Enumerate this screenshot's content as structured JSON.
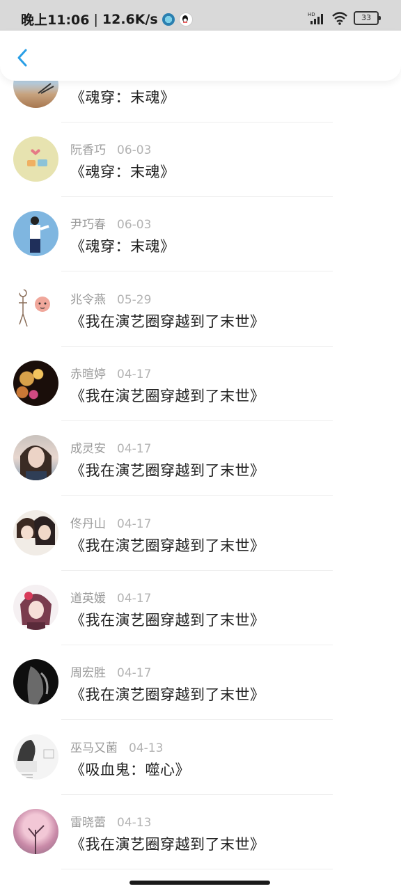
{
  "status_bar": {
    "time": "晚上11:06",
    "separator": "|",
    "speed": "12.6K/s",
    "battery": "33",
    "hd_label": "HD"
  },
  "header": {
    "back_icon": "chevron-left-icon"
  },
  "colors": {
    "accent": "#2a9fe6",
    "divider": "#eeeeee",
    "name_gray": "#9a9a9a"
  },
  "rows": [
    {
      "name": "",
      "date": "",
      "book": "《魂穿：末魂》",
      "avatar": "beach-avatar"
    },
    {
      "name": "阮香巧",
      "date": "06-03",
      "book": "《魂穿：末魂》",
      "avatar": "cute-items-avatar"
    },
    {
      "name": "尹巧春",
      "date": "06-03",
      "book": "《魂穿：末魂》",
      "avatar": "boy-illustration-avatar"
    },
    {
      "name": "兆令燕",
      "date": "05-29",
      "book": "《我在演艺圈穿越到了末世》",
      "avatar": "cartoon-avatar"
    },
    {
      "name": "赤暄婷",
      "date": "04-17",
      "book": "《我在演艺圈穿越到了末世》",
      "avatar": "bokeh-lights-avatar"
    },
    {
      "name": "成灵安",
      "date": "04-17",
      "book": "《我在演艺圈穿越到了末世》",
      "avatar": "woman-photo-avatar"
    },
    {
      "name": "佟丹山",
      "date": "04-17",
      "book": "《我在演艺圈穿越到了末世》",
      "avatar": "anime-couple-avatar"
    },
    {
      "name": "道英媛",
      "date": "04-17",
      "book": "《我在演艺圈穿越到了末世》",
      "avatar": "anime-girl-avatar"
    },
    {
      "name": "周宏胜",
      "date": "04-17",
      "book": "《我在演艺圈穿越到了末世》",
      "avatar": "dark-hand-avatar"
    },
    {
      "name": "巫马又菌",
      "date": "04-13",
      "book": "《吸血鬼：噬心》",
      "avatar": "sketch-avatar"
    },
    {
      "name": "雷晓蕾",
      "date": "04-13",
      "book": "《我在演艺圈穿越到了末世》",
      "avatar": "pink-tree-avatar"
    }
  ]
}
